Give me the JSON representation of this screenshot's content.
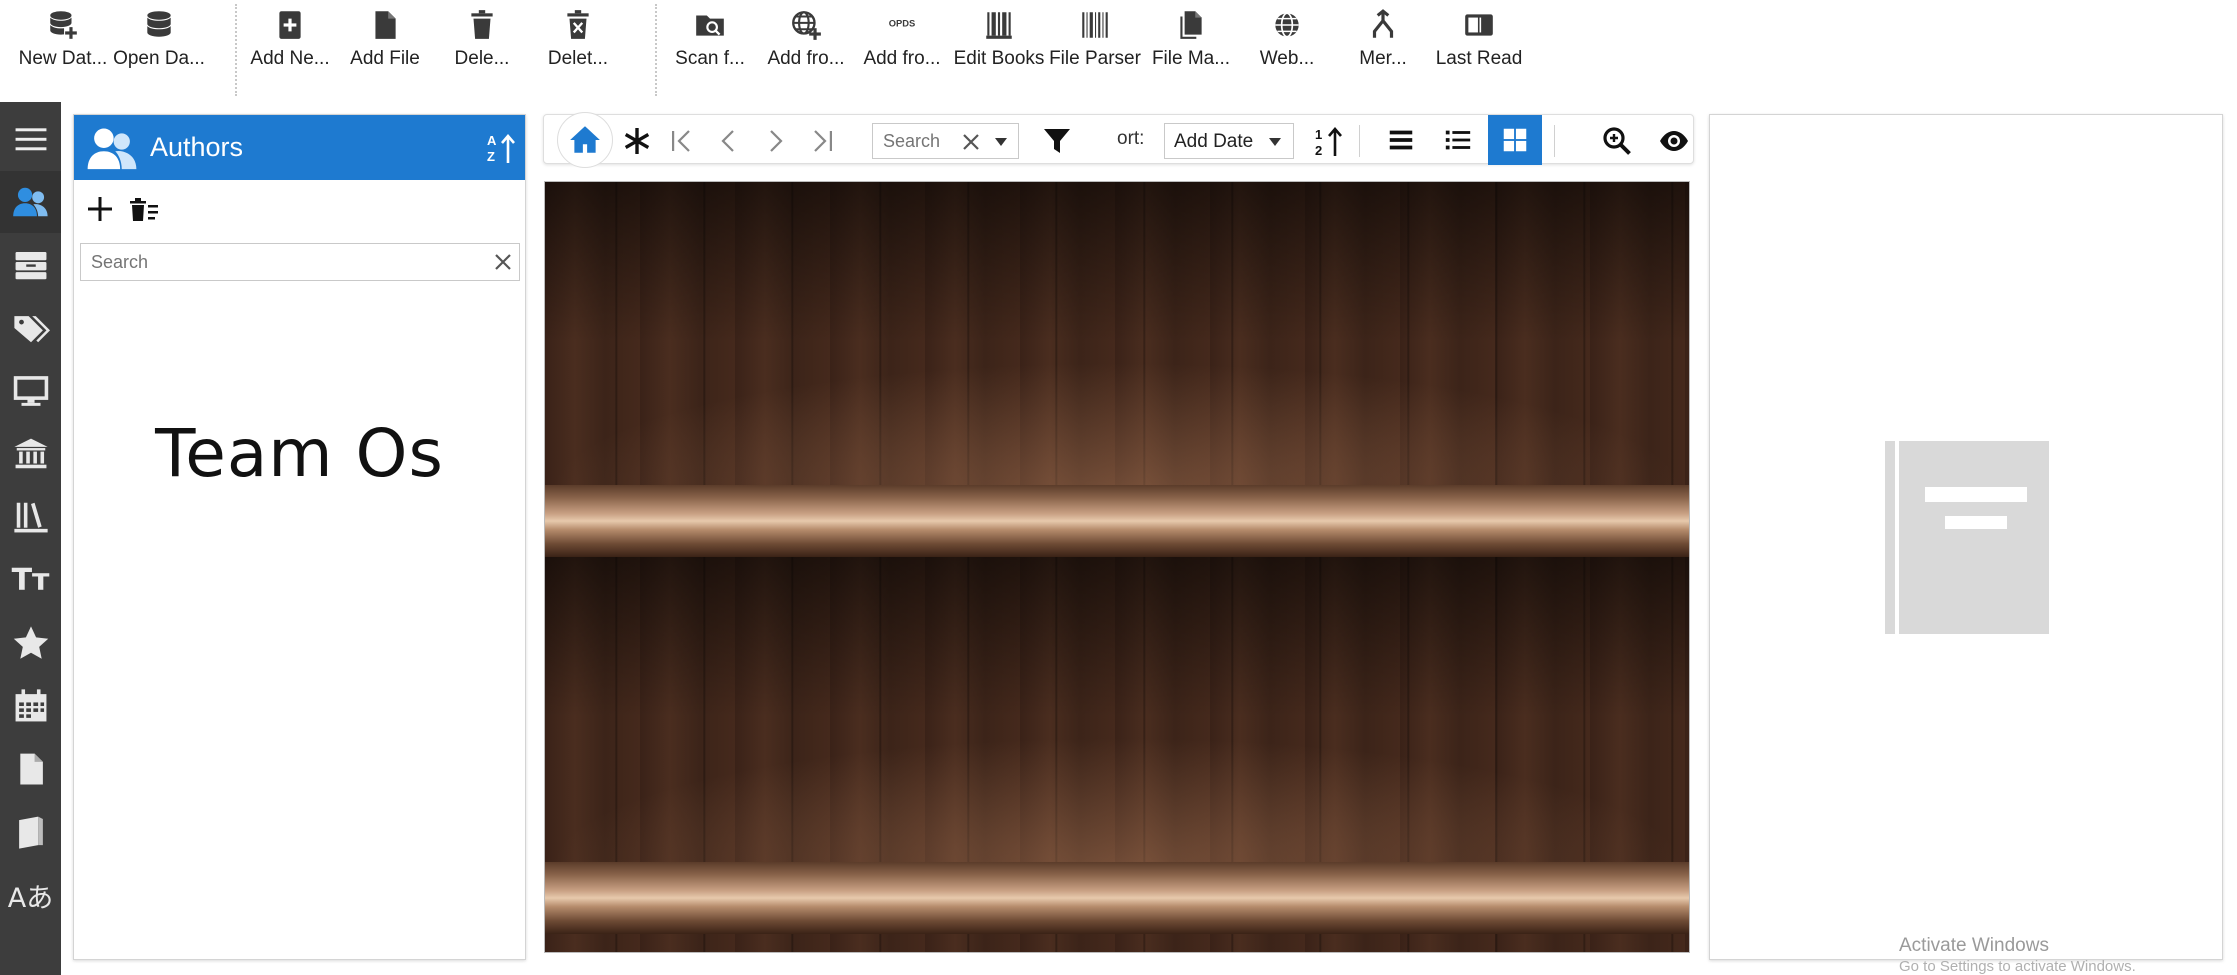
{
  "ribbon": {
    "buttons": [
      {
        "label": "New Dat...",
        "icon": "database-add-icon"
      },
      {
        "label": "Open Da...",
        "icon": "database-icon"
      },
      {
        "label": "Add Ne...",
        "icon": "book-add-icon"
      },
      {
        "label": "Add File",
        "icon": "file-icon"
      },
      {
        "label": "Dele...",
        "icon": "trash-icon"
      },
      {
        "label": "Delet...",
        "icon": "trash-x-icon"
      },
      {
        "label": "Scan f...",
        "icon": "folder-search-icon"
      },
      {
        "label": "Add fro...",
        "icon": "globe-add-icon"
      },
      {
        "label": "Add fro...",
        "icon": "opds-icon",
        "badge": "OPDS"
      },
      {
        "label": "Edit Books",
        "icon": "books-edit-icon"
      },
      {
        "label": "File Parser",
        "icon": "barcode-icon"
      },
      {
        "label": "File Ma...",
        "icon": "files-icon"
      },
      {
        "label": "Web...",
        "icon": "web-icon"
      },
      {
        "label": "Mer...",
        "icon": "merge-icon"
      },
      {
        "label": "Last Read",
        "icon": "reader-icon"
      }
    ]
  },
  "authors": {
    "title": "Authors",
    "search_placeholder": "Search",
    "entries": [
      "Team Os"
    ]
  },
  "toolbar": {
    "search_placeholder": "Search",
    "sort_label": "ort:",
    "sort_value": "Add Date"
  },
  "nav": {
    "text_icon": "Tт",
    "lang_icon": "Aあ"
  },
  "watermark": {
    "line1": "Activate Windows",
    "line2": "Go to Settings to activate Windows."
  },
  "colors": {
    "accent": "#1e7ad0",
    "nav_bg": "#3d3d3d",
    "icon_dark": "#3a3a3a"
  }
}
